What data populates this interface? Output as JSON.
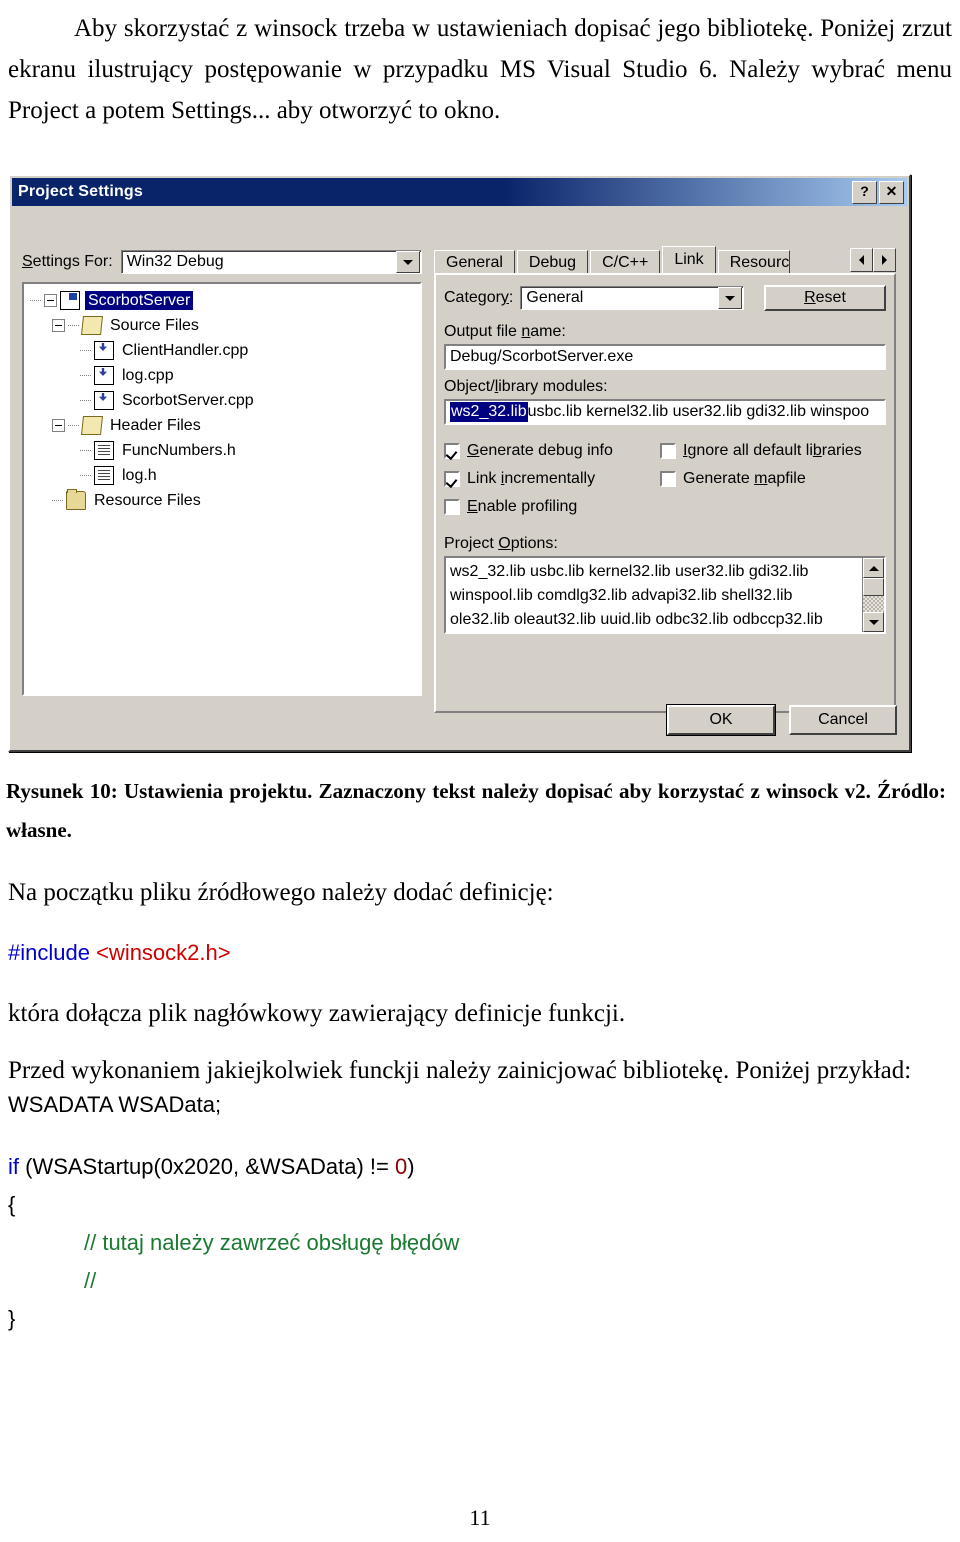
{
  "document": {
    "intro_paragraph": "Aby skorzystać z winsock trzeba w ustawieniach dopisać jego bibliotekę. Poniżej zrzut ekranu ilustrujący postępowanie w przypadku MS Visual Studio 6. Należy wybrać menu Project a potem Settings... aby otworzyć to okno.",
    "figure_caption": "Rysunek 10: Ustawienia projektu. Zaznaczony tekst należy dopisać aby korzystać z winsock v2. Źródlo: własne.",
    "para_after_figure": "Na początku pliku źródłowego należy dodać definicję:",
    "include_directive": "#include",
    "include_header": "<winsock2.h>",
    "para_header_desc": "która dołącza plik nagłówkowy zawierający definicje funkcji.",
    "para_init_desc": "Przed wykonaniem jakiejkolwiek funckji należy zainicjować bibliotekę. Poniżej przykład:",
    "page_number": "11"
  },
  "code_sample": {
    "line1": "WSADATA WSAData;",
    "line2_kw": "if",
    "line2_rest": " (WSAStartup(0x2020, &WSAData) !=",
    "line2_num": " 0",
    "line2_end": ")",
    "line3": "{",
    "line4_comment": "// tutaj należy zawrzeć obsługę błędów",
    "line5_comment": "//",
    "line6": "}"
  },
  "dialog": {
    "title": "Project Settings",
    "help_button": "?",
    "close_button": "✕",
    "settings_for_label": "Settings For:",
    "settings_for_value": "Win32 Debug",
    "tree": [
      {
        "label": "ScorbotServer",
        "level": 0,
        "icon": "project-icon",
        "expander": "minus",
        "selected": true
      },
      {
        "label": "Source Files",
        "level": 1,
        "icon": "folder-open-icon",
        "expander": "minus",
        "selected": false
      },
      {
        "label": "ClientHandler.cpp",
        "level": 2,
        "icon": "cpp-file-icon",
        "expander": "none",
        "selected": false
      },
      {
        "label": "log.cpp",
        "level": 2,
        "icon": "cpp-file-icon",
        "expander": "none",
        "selected": false
      },
      {
        "label": "ScorbotServer.cpp",
        "level": 2,
        "icon": "cpp-file-icon",
        "expander": "none",
        "selected": false
      },
      {
        "label": "Header Files",
        "level": 1,
        "icon": "folder-open-icon",
        "expander": "minus",
        "selected": false
      },
      {
        "label": "FuncNumbers.h",
        "level": 2,
        "icon": "header-file-icon",
        "expander": "none",
        "selected": false
      },
      {
        "label": "log.h",
        "level": 2,
        "icon": "header-file-icon",
        "expander": "none",
        "selected": false
      },
      {
        "label": "Resource Files",
        "level": 1,
        "icon": "folder-icon",
        "expander": "none",
        "selected": false
      }
    ],
    "tabs": [
      {
        "label": "General",
        "active": false
      },
      {
        "label": "Debug",
        "active": false
      },
      {
        "label": "C/C++",
        "active": false
      },
      {
        "label": "Link",
        "active": true
      },
      {
        "label": "Resource",
        "active": false
      }
    ],
    "category_label": "Category:",
    "category_value": "General",
    "reset_button": "Reset",
    "output_file_label": "Output file name:",
    "output_file_value": "Debug/ScorbotServer.exe",
    "object_modules_label": "Object/library modules:",
    "object_modules_selected": "ws2_32.lib",
    "object_modules_rest": " usbc.lib kernel32.lib user32.lib gdi32.lib winspoo",
    "checkboxes": [
      {
        "label": "Generate debug info",
        "checked": true
      },
      {
        "label": "Ignore all default libraries",
        "checked": false
      },
      {
        "label": "Link incrementally",
        "checked": true
      },
      {
        "label": "Generate mapfile",
        "checked": false
      },
      {
        "label": "Enable profiling",
        "checked": false
      }
    ],
    "project_options_label": "Project Options:",
    "project_options_lines": [
      "ws2_32.lib usbc.lib kernel32.lib user32.lib gdi32.lib",
      "winspool.lib comdlg32.lib advapi32.lib shell32.lib",
      "ole32.lib oleaut32.lib uuid.lib odbc32.lib odbccp32.lib"
    ],
    "ok_button": "OK",
    "cancel_button": "Cancel"
  },
  "colors": {
    "dialog_face": "#d4d0c8",
    "title_active": "#0a246a",
    "selection": "#000080",
    "code_keyword": "#0000d0",
    "code_string": "#d00000",
    "code_number": "#8b0000",
    "code_comment": "#1a7a32"
  }
}
